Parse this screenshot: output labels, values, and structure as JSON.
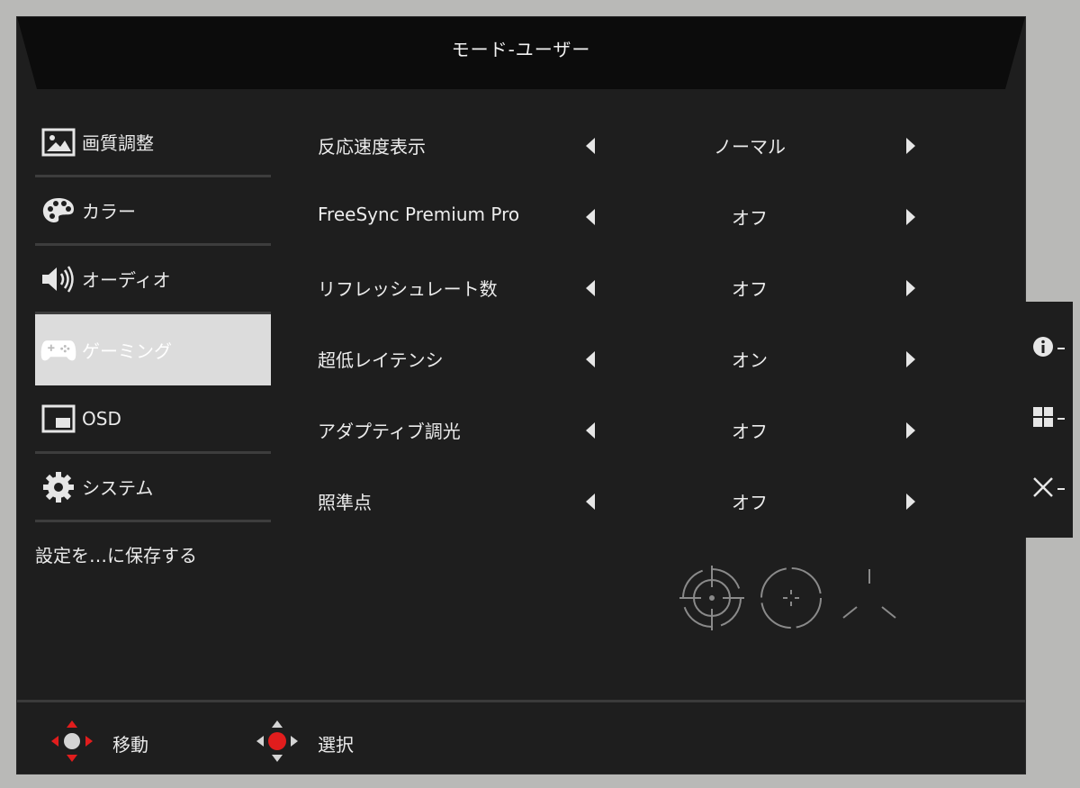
{
  "header": {
    "title": "モード-ユーザー"
  },
  "sidebar": {
    "items": [
      {
        "label": "画質調整",
        "icon": "picture-icon",
        "active": false
      },
      {
        "label": "カラー",
        "icon": "palette-icon",
        "active": false
      },
      {
        "label": "オーディオ",
        "icon": "speaker-icon",
        "active": false
      },
      {
        "label": "ゲーミング",
        "icon": "gamepad-icon",
        "active": true
      },
      {
        "label": "OSD",
        "icon": "osd-window-icon",
        "active": false
      },
      {
        "label": "システム",
        "icon": "gear-icon",
        "active": false
      }
    ],
    "save_label": "設定を…に保存する"
  },
  "settings": [
    {
      "label": "反応速度表示",
      "value": "ノーマル"
    },
    {
      "label": "FreeSync Premium Pro",
      "value": "オフ"
    },
    {
      "label": "リフレッシュレート数",
      "value": "オフ"
    },
    {
      "label": "超低レイテンシ",
      "value": "オン"
    },
    {
      "label": "アダプティブ調光",
      "value": "オフ"
    },
    {
      "label": "照準点",
      "value": "オフ"
    }
  ],
  "crosshair_options": [
    "crosshair-circle-icon",
    "crosshair-ring-icon",
    "crosshair-tri-icon"
  ],
  "footer": {
    "move_label": "移動",
    "select_label": "選択"
  },
  "side_panel": [
    "info-icon",
    "grid-icon",
    "close-icon"
  ],
  "colors": {
    "accent": "#e11d1d",
    "background": "#1e1e1e",
    "divider": "#3d3d3d"
  }
}
